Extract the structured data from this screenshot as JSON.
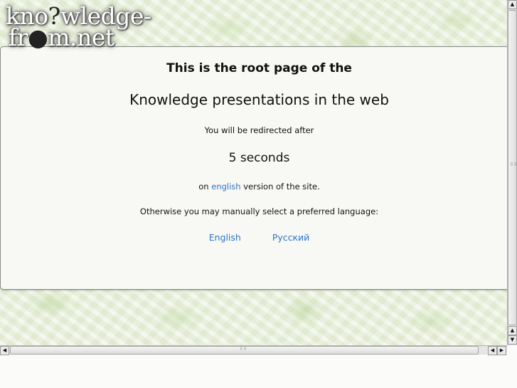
{
  "logo": {
    "line1": "kno",
    "line1_q": "?",
    "line1_rest": "wledge-",
    "line2": "fr",
    "line2_q": "●",
    "line2_rest": "m.net"
  },
  "content": {
    "title": "This is the root page of the",
    "subtitle": "Knowledge presentations in the web",
    "redirect_text": "You will be redirected after",
    "countdown": "5 seconds",
    "version_prefix": "on",
    "version_link": "english",
    "version_suffix": "version of the site.",
    "manual_text": "Otherwise you may manually select a preferred language:",
    "languages": [
      {
        "label": "English"
      },
      {
        "label": "Русский"
      }
    ]
  },
  "colors": {
    "link": "#2b74c9",
    "text": "#111111"
  },
  "scrollbars": {
    "up_icon": "▲",
    "down_icon": "▼",
    "left_icon": "◀",
    "right_icon": "▶",
    "grip": "⠿⠿"
  }
}
